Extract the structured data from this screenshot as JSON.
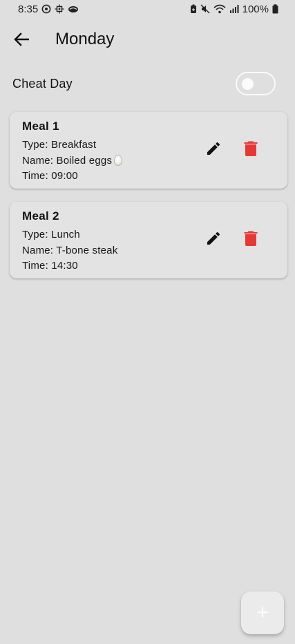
{
  "status_bar": {
    "time": "8:35",
    "battery_percent": "100%",
    "icons_left": [
      "whatsapp-like-icon",
      "settings-gear-icon",
      "cloud-icon"
    ],
    "icons_right": [
      "battery-saver-icon",
      "mute-icon",
      "wifi-icon",
      "signal-icon",
      "battery-icon"
    ]
  },
  "app_bar": {
    "back_icon": "arrow-back-icon",
    "title": "Monday"
  },
  "cheat_day": {
    "label": "Cheat Day",
    "enabled": false
  },
  "meals": [
    {
      "title": "Meal 1",
      "type": "Type: Breakfast",
      "name": "Name: Boiled eggs",
      "name_emoji": "egg-emoji",
      "time": "Time: 09:00"
    },
    {
      "title": "Meal 2",
      "type": "Type: Lunch",
      "name": "Name: T-bone steak",
      "time": "Time: 14:30"
    }
  ],
  "actions": {
    "edit_icon": "pencil-icon",
    "delete_icon": "trash-icon",
    "delete_color": "#e53935",
    "edit_color": "#111111"
  },
  "fab": {
    "label": "+",
    "icon": "plus-icon"
  },
  "colors": {
    "background": "#dfdfdf",
    "card": "#e3e3e3",
    "fab": "#ebebeb"
  }
}
